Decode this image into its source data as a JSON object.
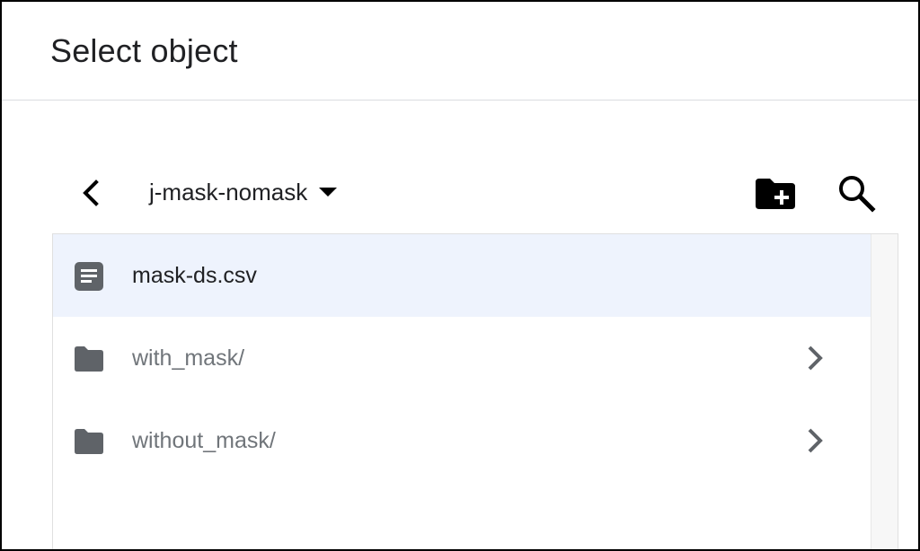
{
  "dialog": {
    "title": "Select object"
  },
  "toolbar": {
    "back_icon": "back-arrow-icon",
    "bucket_name": "j-mask-nomask",
    "dropdown_icon": "caret-down-icon",
    "new_folder_icon": "create-new-folder-icon",
    "search_icon": "search-icon"
  },
  "items": [
    {
      "name": "mask-ds.csv",
      "type": "file",
      "icon": "file-document-icon",
      "selected": true
    },
    {
      "name": "with_mask/",
      "type": "folder",
      "icon": "folder-icon",
      "chevron_icon": "chevron-right-icon"
    },
    {
      "name": "without_mask/",
      "type": "folder",
      "icon": "folder-icon",
      "chevron_icon": "chevron-right-icon"
    }
  ],
  "colors": {
    "selected_row_bg": "#eef3fd",
    "icon_dark": "#000000",
    "icon_gray": "#5f6368",
    "file_text": "#202124",
    "folder_text": "#70757a"
  }
}
